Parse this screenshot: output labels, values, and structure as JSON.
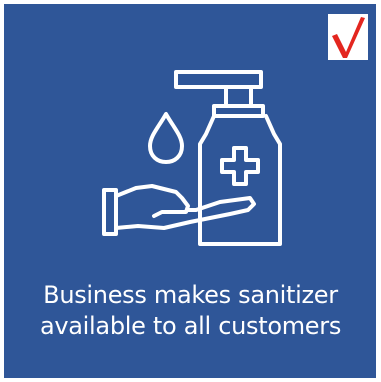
{
  "colors": {
    "tile_background": "#2f5698",
    "line_art": "#ffffff",
    "badge_background": "#ffffff",
    "badge_mark": "#e3261f"
  },
  "badge": {
    "icon": "checkmark-icon"
  },
  "illustration": {
    "icon": "hand-sanitizer-icon"
  },
  "caption": {
    "line1": "Business makes sanitizer",
    "line2": "available to all customers"
  }
}
